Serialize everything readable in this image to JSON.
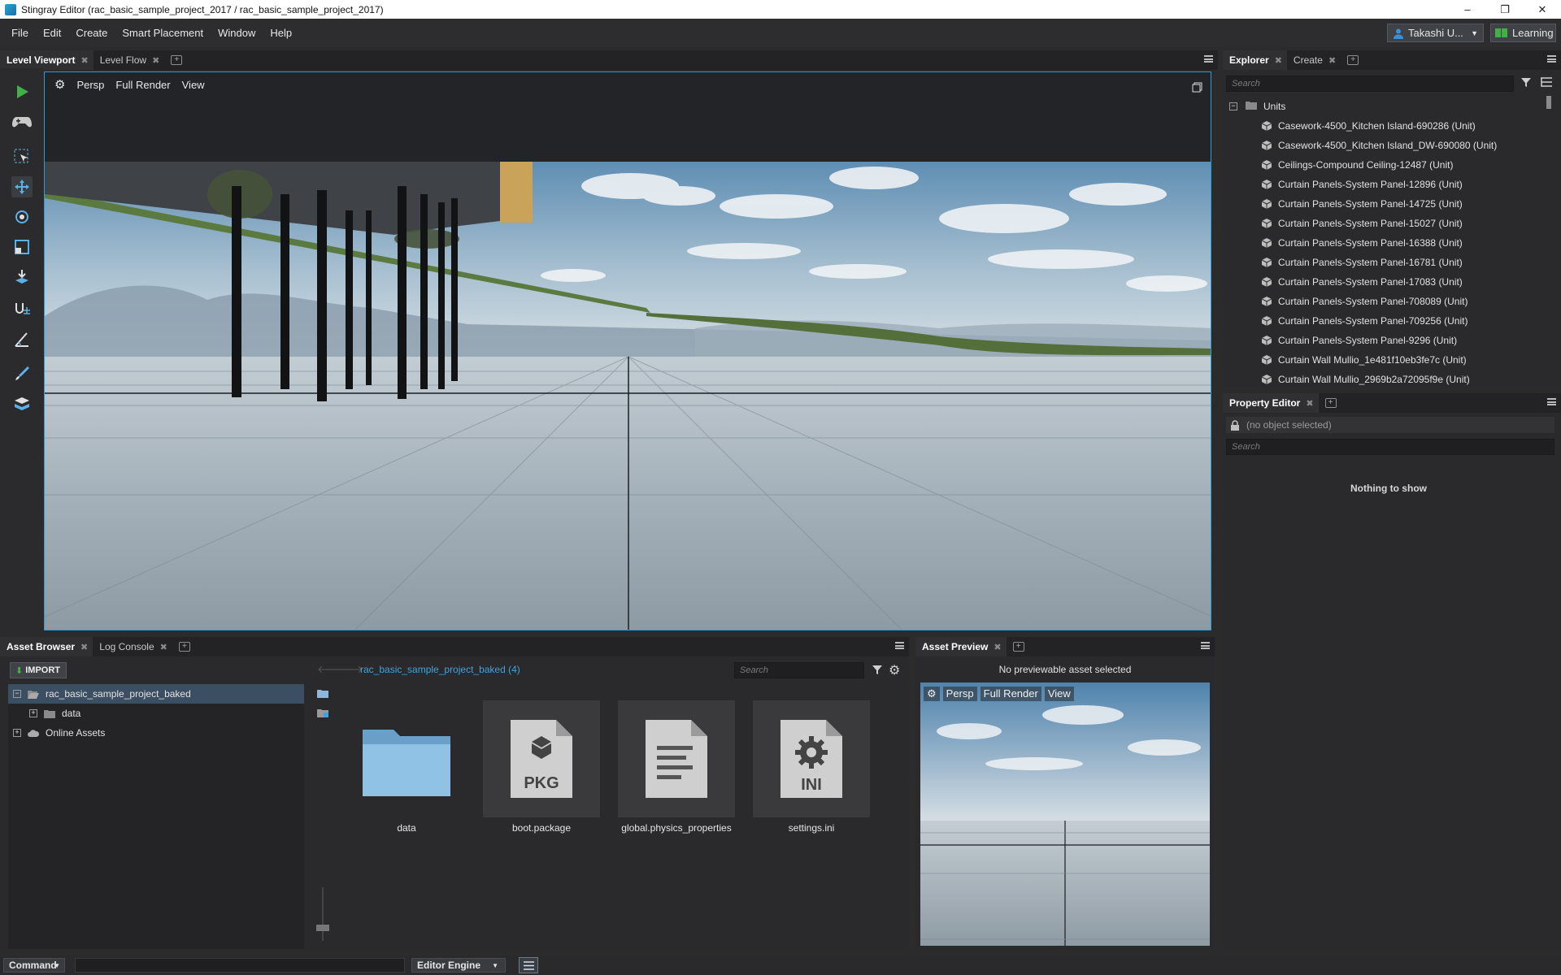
{
  "window": {
    "title": "Stingray Editor (rac_basic_sample_project_2017 / rac_basic_sample_project_2017)",
    "minimize": "–",
    "restore": "❐",
    "close": "✕"
  },
  "menu": [
    "File",
    "Edit",
    "Create",
    "Smart Placement",
    "Window",
    "Help"
  ],
  "user": {
    "name": "Takashi U...",
    "learning": "Learning"
  },
  "viewport_tabs": [
    {
      "label": "Level Viewport",
      "active": true
    },
    {
      "label": "Level Flow",
      "active": false
    }
  ],
  "viewport": {
    "options": [
      "Persp",
      "Full Render",
      "View"
    ]
  },
  "explorer": {
    "tabs": [
      "Explorer",
      "Create"
    ],
    "search_placeholder": "Search",
    "root": "Units",
    "items": [
      "Casework-4500_Kitchen Island-690286 (Unit)",
      "Casework-4500_Kitchen Island_DW-690080 (Unit)",
      "Ceilings-Compound Ceiling-12487 (Unit)",
      "Curtain Panels-System Panel-12896 (Unit)",
      "Curtain Panels-System Panel-14725 (Unit)",
      "Curtain Panels-System Panel-15027 (Unit)",
      "Curtain Panels-System Panel-16388 (Unit)",
      "Curtain Panels-System Panel-16781 (Unit)",
      "Curtain Panels-System Panel-17083 (Unit)",
      "Curtain Panels-System Panel-708089 (Unit)",
      "Curtain Panels-System Panel-709256 (Unit)",
      "Curtain Panels-System Panel-9296 (Unit)",
      "Curtain Wall Mullio_1e481f10eb3fe7c (Unit)",
      "Curtain Wall Mullio_2969b2a72095f9e (Unit)"
    ]
  },
  "property_editor": {
    "tab": "Property Editor",
    "selection": "(no object selected)",
    "search_placeholder": "Search",
    "empty": "Nothing to show"
  },
  "asset_browser": {
    "tabs": [
      "Asset Browser",
      "Log Console"
    ],
    "import_label": "IMPORT",
    "path": "rac_basic_sample_project_baked (4)",
    "search_placeholder": "Search",
    "tree": [
      {
        "label": "rac_basic_sample_project_baked",
        "toggle": "−",
        "selected": true
      },
      {
        "label": "data",
        "toggle": "+"
      },
      {
        "label": "Online Assets",
        "toggle": "+"
      }
    ],
    "assets": [
      {
        "label": "data",
        "kind": "folder"
      },
      {
        "label": "boot.package",
        "kind": "PKG"
      },
      {
        "label": "global.physics_properties",
        "kind": "doc"
      },
      {
        "label": "settings.ini",
        "kind": "INI"
      }
    ]
  },
  "asset_preview": {
    "tab": "Asset Preview",
    "message": "No previewable asset selected",
    "options": [
      "Persp",
      "Full Render",
      "View"
    ]
  },
  "statusbar": {
    "command_label": "Command",
    "engine_label": "Editor Engine"
  },
  "colors": {
    "accent": "#2f9bd6",
    "play": "#3fb04a"
  }
}
